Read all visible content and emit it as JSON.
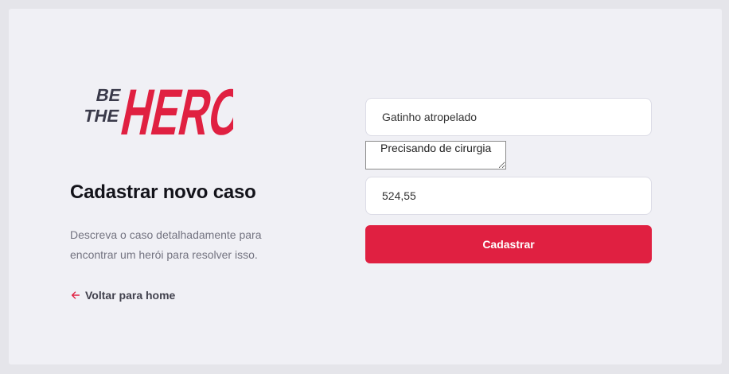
{
  "logo": {
    "line1": "BE",
    "line2": "THE",
    "hero": "HERO",
    "colors": {
      "dark": "#3a3a4a",
      "accent": "#e02041"
    }
  },
  "page": {
    "title": "Cadastrar novo caso",
    "description": "Descreva o caso detalhadamente para encontrar um herói para resolver isso."
  },
  "back_link": {
    "icon": "arrow-left-icon",
    "label": "Voltar para home"
  },
  "form": {
    "title_value": "Gatinho atropelado",
    "description_value": "Precisando de cirurgia",
    "value_value": "524,55",
    "submit_label": "Cadastrar"
  },
  "colors": {
    "background": "#e5e5ea",
    "card": "#f0f0f5",
    "accent": "#e02041",
    "text_dark": "#13131a",
    "text_muted": "#737380"
  }
}
